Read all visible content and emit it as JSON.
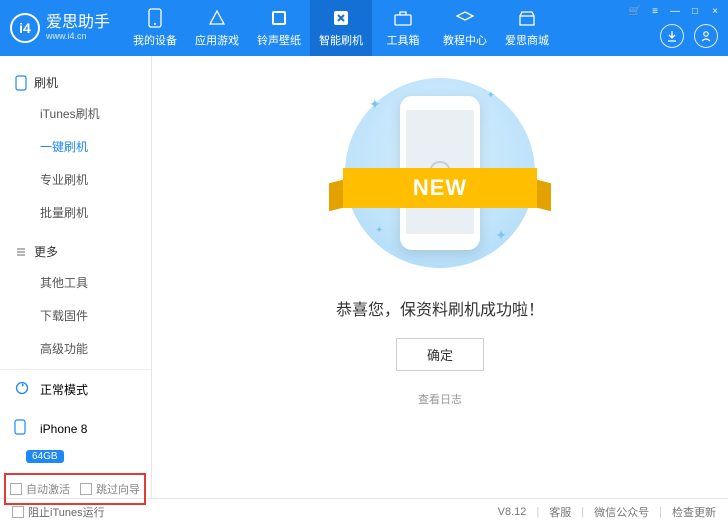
{
  "brand": {
    "name": "爱思助手",
    "url": "www.i4.cn",
    "logo_letters": "i4"
  },
  "window_controls": {
    "cart": "🛒",
    "menu": "≡",
    "min": "—",
    "max": "□",
    "close": "×"
  },
  "header_tabs": [
    {
      "label": "我的设备"
    },
    {
      "label": "应用游戏"
    },
    {
      "label": "铃声壁纸"
    },
    {
      "label": "智能刷机",
      "active": true
    },
    {
      "label": "工具箱"
    },
    {
      "label": "教程中心"
    },
    {
      "label": "爱思商城"
    }
  ],
  "header_icons": {
    "download": "↓",
    "user": "◯"
  },
  "sidebar": {
    "section1": {
      "title": "刷机",
      "items": [
        {
          "label": "iTunes刷机"
        },
        {
          "label": "一键刷机",
          "active": true
        },
        {
          "label": "专业刷机"
        },
        {
          "label": "批量刷机"
        }
      ]
    },
    "section2": {
      "title": "更多",
      "items": [
        {
          "label": "其他工具"
        },
        {
          "label": "下载固件"
        },
        {
          "label": "高级功能"
        }
      ]
    },
    "mode": {
      "label": "正常模式"
    },
    "device": {
      "name": "iPhone 8",
      "capacity": "64GB"
    },
    "checkboxes": {
      "auto_activate": "自动激活",
      "skip_guide": "跳过向导"
    }
  },
  "main": {
    "ribbon": "NEW",
    "success": "恭喜您，保资料刷机成功啦！",
    "ok": "确定",
    "view_log": "查看日志"
  },
  "footer": {
    "block_itunes": "阻止iTunes运行",
    "version": "V8.12",
    "support": "客服",
    "wechat": "微信公众号",
    "update": "检查更新"
  }
}
